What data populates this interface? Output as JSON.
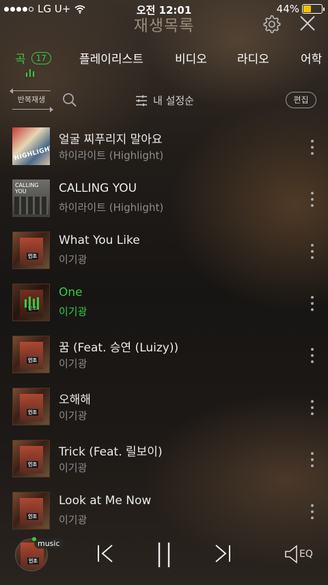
{
  "status_bar": {
    "carrier": "LG U+",
    "time": "오전 12:01",
    "battery_percent": "44%",
    "battery_level": 0.44,
    "signal_bars": 4
  },
  "header": {
    "title": "재생목록",
    "settings_icon": "gear-icon",
    "close_icon": "close-icon"
  },
  "tabs": [
    {
      "label": "곡",
      "badge": "17",
      "active": true
    },
    {
      "label": "플레이리스트"
    },
    {
      "label": "비디오"
    },
    {
      "label": "라디오"
    },
    {
      "label": "어학"
    }
  ],
  "toolbar": {
    "repeat_label": "반복재생",
    "sort_label": "내 설정순",
    "edit_label": "편집"
  },
  "songs": [
    {
      "title": "얼굴 찌푸리지 말아요",
      "artist": "하이라이트 (Highlight)",
      "cover": "highlight-1",
      "cover_text": "HIGHLIGHT"
    },
    {
      "title": "CALLING YOU",
      "artist": "하이라이트 (Highlight)",
      "cover": "highlight-2",
      "cover_text": "CALLING YOU"
    },
    {
      "title": "What You Like",
      "artist": "이기광",
      "cover": "lee-kikwang",
      "cover_text": "인조"
    },
    {
      "title": "One",
      "artist": "이기광",
      "cover": "lee-kikwang",
      "cover_text": "인조",
      "playing": true
    },
    {
      "title": "꿈 (Feat. 승연 (Luizy))",
      "artist": "이기광",
      "cover": "lee-kikwang",
      "cover_text": "인조"
    },
    {
      "title": "오해해",
      "artist": "이기광",
      "cover": "lee-kikwang",
      "cover_text": "인조"
    },
    {
      "title": "Trick (Feat. 릴보이)",
      "artist": "이기광",
      "cover": "lee-kikwang",
      "cover_text": "인조"
    },
    {
      "title": "Look at Me Now",
      "artist": "이기광",
      "cover": "lee-kikwang",
      "cover_text": "인조"
    }
  ],
  "player": {
    "badge": "music",
    "cover_text": "인조",
    "eq_label": "EQ",
    "controls": [
      "previous-icon",
      "pause-icon",
      "next-icon",
      "speaker-icon"
    ]
  },
  "colors": {
    "accent": "#33cc44",
    "title_muted": "#9b8c7c",
    "battery": "#f2c200"
  }
}
